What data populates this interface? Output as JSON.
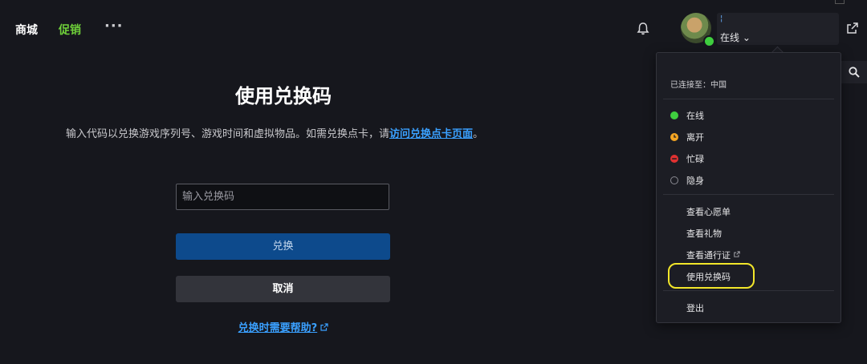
{
  "nav": {
    "store": "商城",
    "sale": "促销",
    "more": "···"
  },
  "user": {
    "name": "¦",
    "status": "在线 ⌄"
  },
  "page": {
    "title": "使用兑换码",
    "description_prefix": "输入代码以兑换游戏序列号、游戏时间和虚拟物品。如需兑换点卡，请",
    "description_link": "访问兑换点卡页面",
    "description_suffix": "。",
    "input_placeholder": "输入兑换码",
    "redeem_label": "兑换",
    "cancel_label": "取消",
    "help_label": "兑换时需要帮助?"
  },
  "menu": {
    "connected": "已连接至：中国",
    "statuses": [
      {
        "label": "在线",
        "color": "#3fcf3f",
        "icon": "online-dot"
      },
      {
        "label": "离开",
        "color": "#f5a623",
        "icon": "away-clock"
      },
      {
        "label": "忙碌",
        "color": "#e03131",
        "icon": "busy-minus"
      },
      {
        "label": "隐身",
        "color": "#8a8a92",
        "icon": "invisible-ring"
      }
    ],
    "items": [
      {
        "label": "查看心愿单"
      },
      {
        "label": "查看礼物"
      },
      {
        "label": "查看通行证",
        "external": true
      },
      {
        "label": "使用兑换码",
        "highlighted": true
      },
      {
        "label": "登出"
      }
    ]
  },
  "colors": {
    "background": "#16171d",
    "accent_green": "#6fd03a",
    "link_blue": "#3aa0ff",
    "primary_button": "#0d4a8c",
    "highlight_ring": "#f2e62a"
  }
}
